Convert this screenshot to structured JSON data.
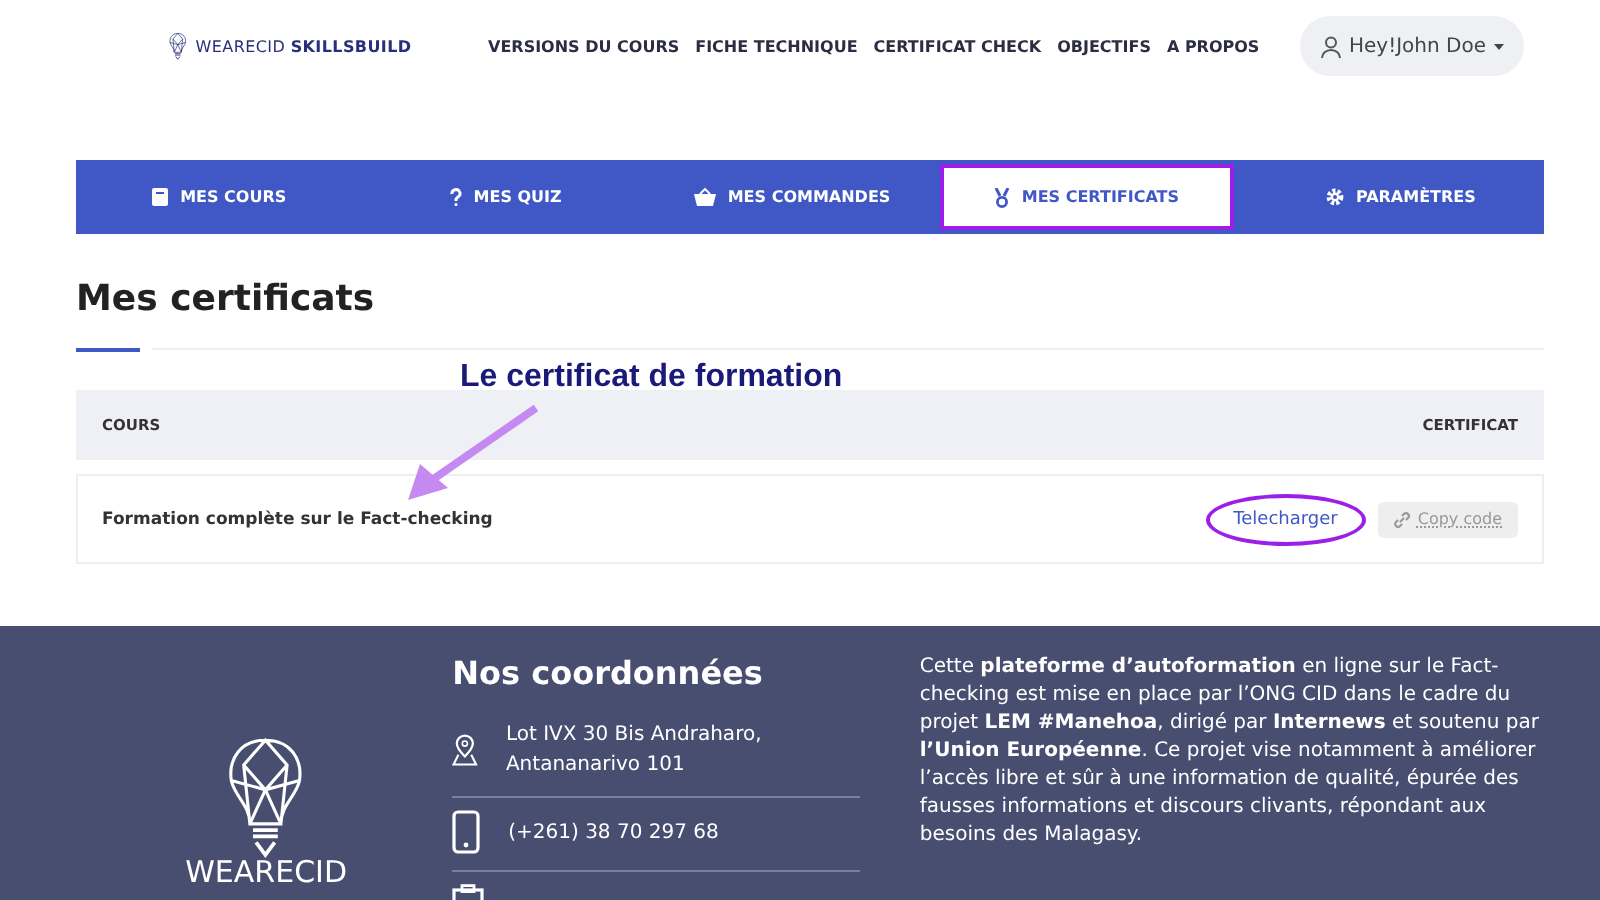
{
  "header": {
    "logo": {
      "light": "WEARECID",
      "bold": "SKILLSBUILD"
    },
    "nav": [
      "VERSIONS DU COURS",
      "FICHE TECHNIQUE",
      "CERTIFICAT CHECK",
      "OBJECTIFS",
      "A PROPOS"
    ],
    "user": "Hey!John Doe"
  },
  "tabs": [
    {
      "label": "MES COURS",
      "kind": "book",
      "selected": false
    },
    {
      "label": "MES QUIZ",
      "kind": "question",
      "selected": false
    },
    {
      "label": "MES COMMANDES",
      "kind": "basket",
      "selected": false
    },
    {
      "label": "MES CERTIFICATS",
      "kind": "medal",
      "selected": true
    },
    {
      "label": "PARAMÈTRES",
      "kind": "gear",
      "selected": false
    }
  ],
  "page_title": "Mes certificats",
  "annotation": "Le certificat de formation",
  "table": {
    "columns": [
      "COURS",
      "CERTIFICAT"
    ],
    "rows": [
      {
        "course": "Formation complète sur le Fact-checking",
        "download": "Telecharger",
        "copy": "Copy code"
      }
    ]
  },
  "footer": {
    "logo": {
      "light": "WEARECID"
    },
    "contact_title": "Nos coordonnées",
    "contacts": [
      {
        "kind": "map",
        "text": "Lot IVX 30 Bis Andraharo, Antananarivo 101"
      },
      {
        "kind": "phone",
        "text": "(+261) 38 70 297 68"
      },
      {
        "kind": "clipboard"
      }
    ],
    "about": "Cette **plateforme d’autoformation** en ligne sur le Fact-checking est mise en place par l’ONG CID dans le cadre du projet **LEM #Manehoa**, dirigé par **Internews** et soutenu par **l’Union Européenne**. Ce projet vise notamment à améliorer l’accès libre et sûr à une information de qualité, épurée des fausses informations et discours clivants, répondant aux besoins des Malagasy."
  }
}
